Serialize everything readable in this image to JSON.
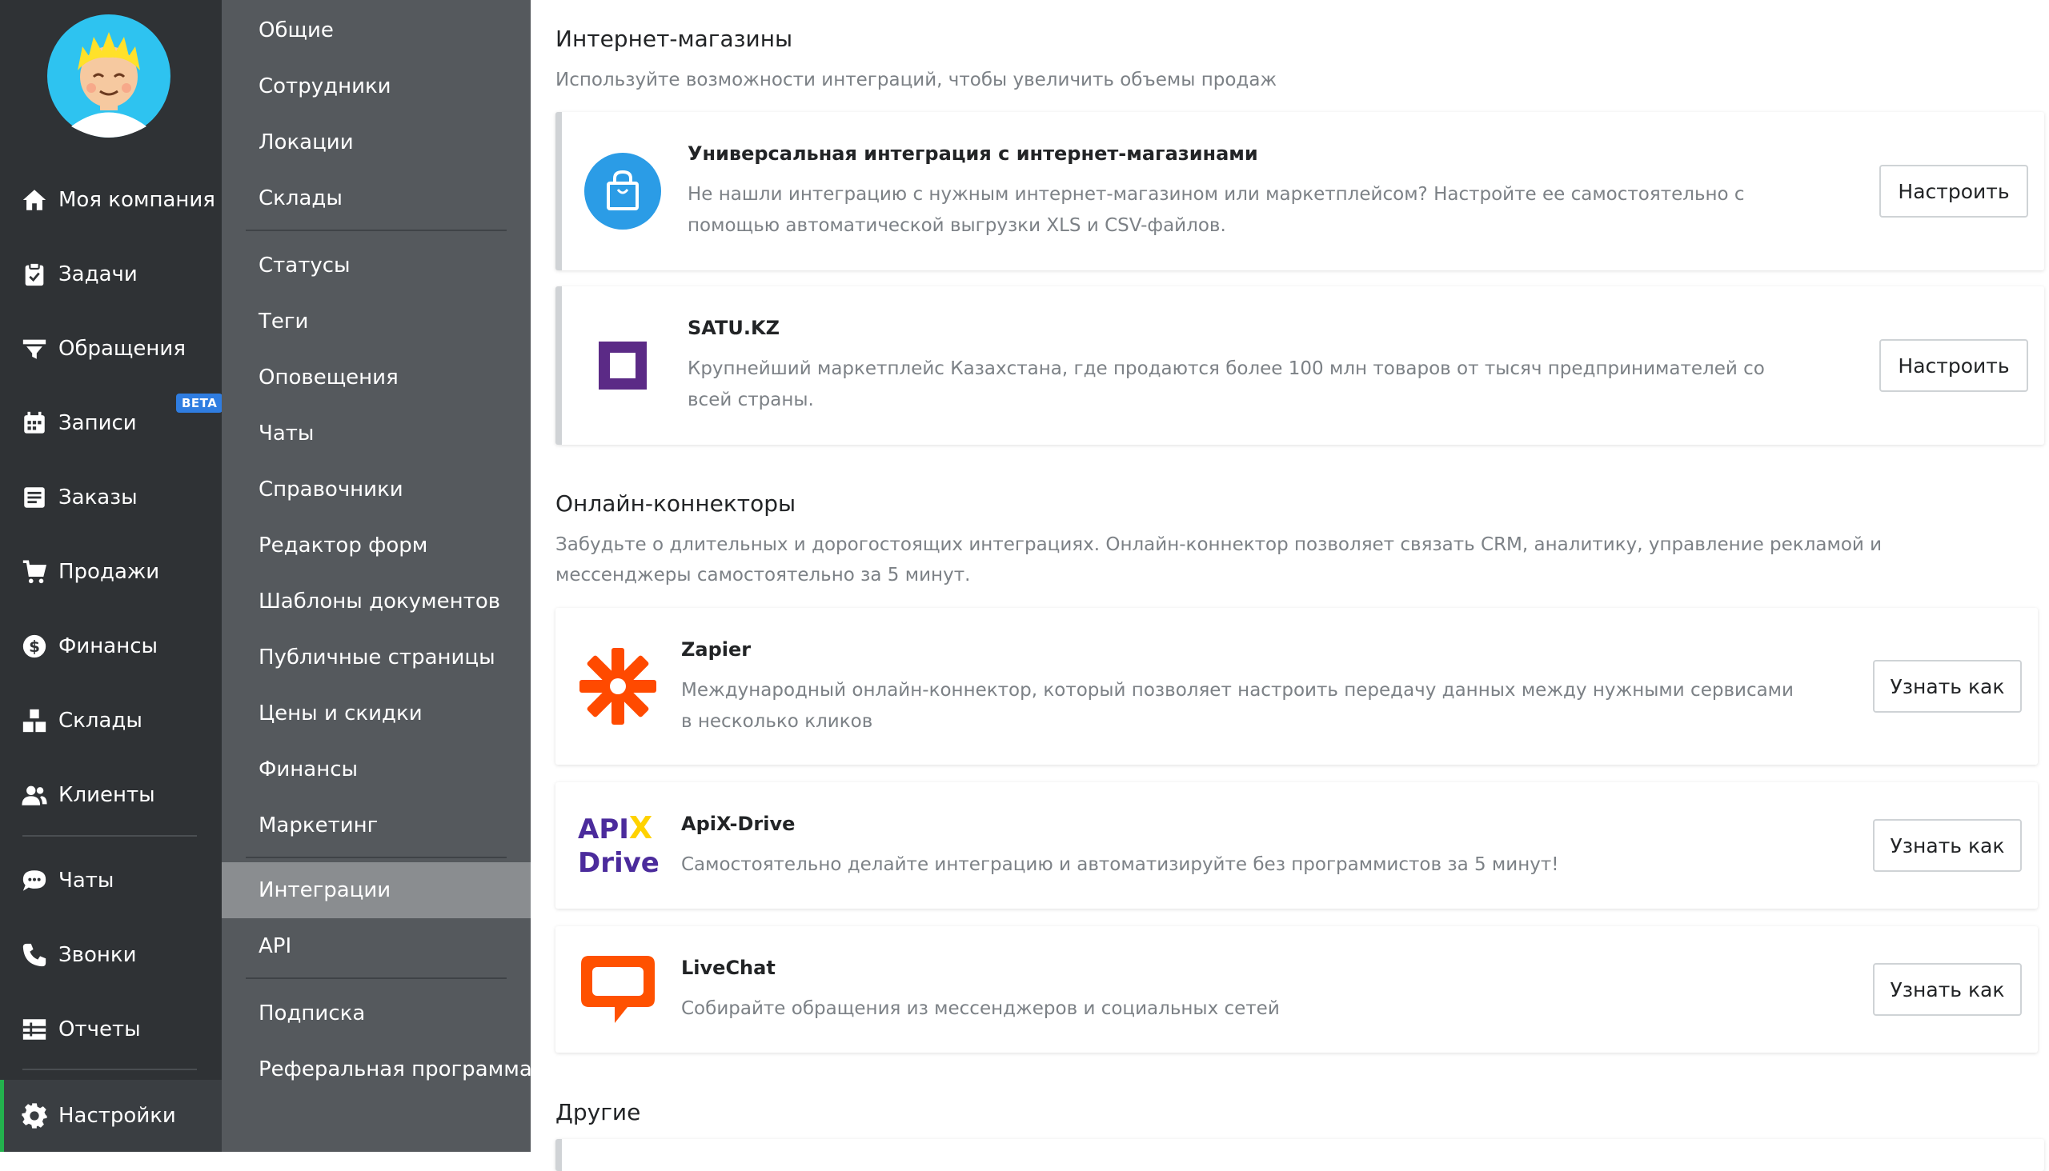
{
  "main_nav": {
    "items": [
      {
        "label": "Моя компания",
        "icon": "home-icon"
      },
      {
        "label": "Задачи",
        "icon": "clipboard-icon"
      },
      {
        "label": "Обращения",
        "icon": "funnel-icon"
      },
      {
        "label": "Записи",
        "icon": "calendar-icon"
      },
      {
        "label": "Заказы",
        "icon": "orders-icon"
      },
      {
        "label": "Продажи",
        "icon": "cart-icon"
      },
      {
        "label": "Финансы",
        "icon": "dollar-icon"
      },
      {
        "label": "Склады",
        "icon": "boxes-icon"
      },
      {
        "label": "Клиенты",
        "icon": "users-icon"
      },
      {
        "label": "Чаты",
        "icon": "chat-icon"
      },
      {
        "label": "Звонки",
        "icon": "phone-icon"
      },
      {
        "label": "Отчеты",
        "icon": "report-icon"
      },
      {
        "label": "Настройки",
        "icon": "gear-icon"
      }
    ],
    "beta_badge": "BETA",
    "active": "Настройки"
  },
  "settings_nav": {
    "items": [
      "Общие",
      "Сотрудники",
      "Локации",
      "Склады",
      "Статусы",
      "Теги",
      "Оповещения",
      "Чаты",
      "Справочники",
      "Редактор форм",
      "Шаблоны документов",
      "Публичные страницы",
      "Цены и скидки",
      "Финансы",
      "Маркетинг",
      "Интеграции",
      "API",
      "Подписка",
      "Реферальная программа"
    ],
    "active": "Интеграции"
  },
  "sections": {
    "shops": {
      "title": "Интернет-магазины",
      "desc": "Используйте возможности интеграций, чтобы увеличить объемы продаж",
      "cards": [
        {
          "title": "Универсальная интеграция с интернет-магазинами",
          "desc": "Не нашли интеграцию с нужным интернет-магазином или маркетплейсом? Настройте ее самостоятельно с помощью автоматической выгрузки XLS и CSV-файлов.",
          "button": "Настроить"
        },
        {
          "title": "SATU.KZ",
          "desc": "Крупнейший маркетплейс Казахстана, где продаются более 100 млн товаров от тысяч предпринимателей со всей страны.",
          "button": "Настроить"
        }
      ]
    },
    "connectors": {
      "title": "Онлайн-коннекторы",
      "desc": "Забудьте о длительных и дорогостоящих интеграциях. Онлайн-коннектор позволяет связать CRM, аналитику, управление рекламой и мессенджеры самостоятельно за 5 минут.",
      "cards": [
        {
          "title": "Zapier",
          "desc": "Международный онлайн-коннектор, который позволяет настроить передачу данных между нужными сервисами в несколько кликов",
          "button": "Узнать как"
        },
        {
          "title": "ApiX-Drive",
          "desc": "Самостоятельно делайте интеграцию и автоматизируйте без программистов за 5 минут!",
          "button": "Узнать как",
          "logo_text": [
            "API",
            "X",
            "Drive"
          ]
        },
        {
          "title": "LiveChat",
          "desc": "Собирайте обращения из мессенджеров и социальных сетей",
          "button": "Узнать как"
        }
      ]
    },
    "other": {
      "title": "Другие"
    }
  },
  "colors": {
    "main_nav_bg": "#2f3235",
    "sub_nav_bg": "#55595d",
    "active_sub": "#8a8d90",
    "active_accent": "#23b14d",
    "beta": "#2f7de1",
    "zapier": "#ff4a00",
    "satu": "#5b2a86",
    "apix_purple": "#4b2b9c",
    "apix_yellow": "#ffd200",
    "livechat": "#ff5100",
    "shop_icon": "#2b9ce6"
  }
}
